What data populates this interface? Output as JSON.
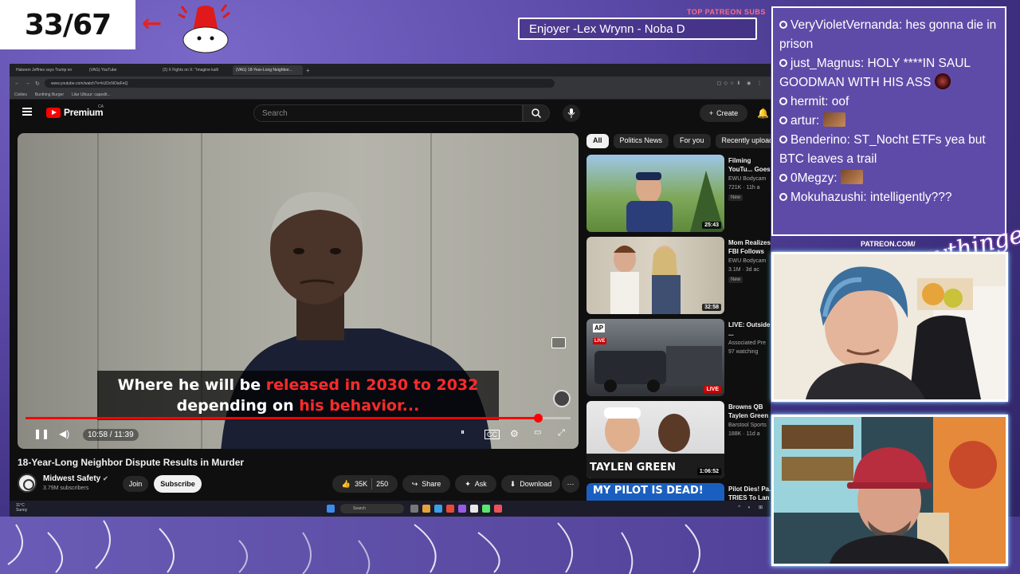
{
  "overlay": {
    "counter": "33/67",
    "patreon_label": "TOP PATREON SUBS",
    "subs_ticker": "Enjoyer -Lex Wrynn -  Noba D",
    "patreon_url": "PATREON.COM/",
    "signature": "Anythingelse"
  },
  "browser": {
    "tabs": [
      {
        "label": "Hakeem Jeffries says Trump on"
      },
      {
        "label": "(VAG) YouTube"
      },
      {
        "label": "(2) X Fights on X: \"Imagine kalli"
      },
      {
        "label": "(VAG) 18-Year-Long Neighbor..."
      }
    ],
    "url": "www.youtube.com/watch?v=kUDcNOiaFeQ",
    "zoom": "150%",
    "bookmarks": [
      "Civilies",
      "Bunthing Burger",
      "Lilar Ulbuur: capedit..."
    ]
  },
  "youtube": {
    "brand": "Premium",
    "region": "CA",
    "search_placeholder": "Search",
    "create_label": "Create",
    "video": {
      "caption_line1_white": "Where he will be ",
      "caption_line1_red": "released in 2030 to 2032",
      "caption_line2_white": "depending on ",
      "caption_line2_red": "his behavior...",
      "time": "10:58 / 11:39",
      "progress": 0.94,
      "title": "18-Year-Long Neighbor Dispute Results in Murder"
    },
    "channel": {
      "name": "Midwest Safety",
      "subs": "3.79M subscribers",
      "join": "Join",
      "subscribe": "Subscribe"
    },
    "actions": {
      "likes": "35K",
      "comments": "250",
      "share": "Share",
      "ask": "Ask",
      "download": "Download"
    },
    "chips": [
      "All",
      "Politics News",
      "For you",
      "Recently uploaded"
    ],
    "recommendations": [
      {
        "title": "Filming YouTu... Goes Wrong...",
        "channel": "EWU Bodycam",
        "meta": "721K · 11h a",
        "badge": "New",
        "duration": "25:43"
      },
      {
        "title": "Mom Realizes FBI Follows Her S",
        "channel": "EWU Bodycam",
        "meta": "3.1M · 3d ac",
        "badge": "New",
        "duration": "32:58"
      },
      {
        "title": "LIVE: Outside ... correspondent",
        "channel": "Associated Pre",
        "meta": "97 watching",
        "badge": "",
        "duration": "LIVE"
      },
      {
        "title": "Browns QB Taylen Green | Gruden's QB",
        "channel": "Barstool Sports",
        "meta": "188K · 11d a",
        "badge": "",
        "duration": "1:06:52"
      },
      {
        "title": "Pilot Dies! Pa... TRIES To Lan",
        "channel": "",
        "meta": "",
        "badge": "",
        "duration": ""
      }
    ],
    "thumb_texts": {
      "ap": "AP",
      "live": "LIVE",
      "green": "TAYLEN GREEN",
      "pilot": "MY PILOT IS DEAD!"
    }
  },
  "taskbar": {
    "weather_temp": "11°C",
    "weather_desc": "Sunny",
    "search": "Search"
  },
  "chat": {
    "messages": [
      {
        "user": "VeryVioletVernanda",
        "text": "hes gonna die in prison"
      },
      {
        "user": "just_Magnus",
        "text": "HOLY ****IN SAUL GOODMAN WITH HIS ASS"
      },
      {
        "user": "hermit",
        "text": "oof"
      },
      {
        "user": "artur",
        "text": ""
      },
      {
        "user": "Benderino",
        "text": "ST_Nocht ETFs yea but BTC leaves a trail"
      },
      {
        "user": "0Megzy",
        "text": ""
      },
      {
        "user": "Mokuhazushi",
        "text": "intelligently???"
      }
    ]
  },
  "colors": {
    "youtube_red": "#ff0000",
    "caption_red": "#ff2a2a",
    "chat_bg": "#5e4ba8",
    "background": "#4b3f8f"
  }
}
